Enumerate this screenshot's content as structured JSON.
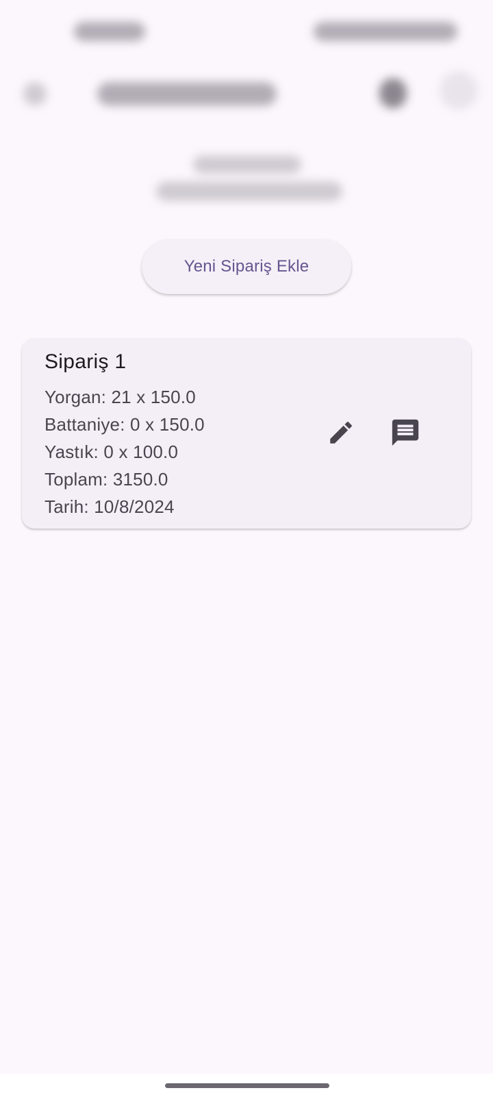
{
  "actions": {
    "add_order_label": "Yeni Sipariş Ekle"
  },
  "order": {
    "title": "Sipariş 1",
    "lines": [
      "Yorgan: 21 x 150.0",
      "Battaniye: 0 x 150.0",
      "Yastık: 0 x 100.0",
      "Toplam: 3150.0",
      "Tarih: 10/8/2024"
    ]
  },
  "icons": {
    "edit": "pencil-icon",
    "comment": "comment-icon"
  },
  "colors": {
    "background": "#fcf7fd",
    "primary_text": "#65558f",
    "card": "#f4eff6"
  }
}
